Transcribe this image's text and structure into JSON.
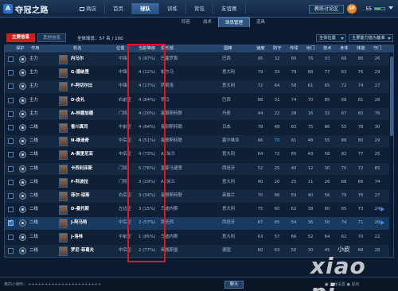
{
  "app": {
    "title": "夺冠之路",
    "logo_mark": "A"
  },
  "nav": [
    "商店",
    "首页",
    "球队",
    "训练",
    "背包",
    "友谊赛"
  ],
  "nav_active": 2,
  "topbar": {
    "forum": "教练讨论区",
    "sp_label": "SP",
    "sp_value": "55",
    "sp_fraction": 0.6
  },
  "subtabs": [
    "阵容",
    "战术",
    "球员管理",
    "道具"
  ],
  "subtab_active": 2,
  "filters": {
    "primary_tab": "主要信息",
    "secondary_tab": "其他信息",
    "count_text": "全体球员：57 名 / 100",
    "position_dropdown": "全体位置",
    "ability_dropdown": "主要能力值为基准"
  },
  "table": {
    "headers": [
      "保护",
      "作用",
      "姓名",
      "位置",
      "当前等级",
      "俱乐部",
      "国籍",
      "速度",
      "防守",
      "传球",
      "射门",
      "技术",
      "身体",
      "体能",
      "守门"
    ],
    "rows": [
      {
        "role": "主力",
        "name": "内马尔",
        "pos": "中锋",
        "starts": "5 (87%)",
        "club": "巴塞罗那",
        "nation": "巴西",
        "stats": [
          "95",
          "32",
          "80",
          "76",
          "93",
          "69",
          "86",
          "26"
        ],
        "hi": [
          4
        ]
      },
      {
        "role": "主力",
        "name": "G-德纳里",
        "pos": "中锋",
        "starts": "4 (12%)",
        "club": "帕尔马",
        "nation": "意大利",
        "stats": [
          "79",
          "33",
          "79",
          "68",
          "77",
          "63",
          "76",
          "29"
        ],
        "hi": []
      },
      {
        "role": "主力",
        "name": "F-阿切尔比",
        "pos": "中锋",
        "starts": "4 (17%)",
        "club": "萨索洛",
        "nation": "意大利",
        "stats": [
          "72",
          "64",
          "58",
          "61",
          "65",
          "72",
          "74",
          "27"
        ],
        "hi": []
      },
      {
        "role": "主力",
        "name": "D-皮礼",
        "pos": "右前卫",
        "starts": "4 (84%)",
        "club": "罗马",
        "nation": "巴西",
        "stats": [
          "88",
          "31",
          "74",
          "70",
          "85",
          "68",
          "81",
          "28"
        ],
        "hi": []
      },
      {
        "role": "主力",
        "name": "A-林德加德",
        "pos": "门将",
        "starts": "4 (20%)",
        "club": "曼联斯特联",
        "nation": "丹麦",
        "stats": [
          "44",
          "22",
          "28",
          "16",
          "32",
          "67",
          "60",
          "76"
        ],
        "hi": []
      },
      {
        "role": "二线",
        "name": "香川真司",
        "pos": "中前卫",
        "starts": "4 (84%)",
        "club": "曼彻斯特联",
        "nation": "日本",
        "stats": [
          "78",
          "48",
          "83",
          "75",
          "86",
          "55",
          "78",
          "30"
        ],
        "hi": []
      },
      {
        "role": "二线",
        "name": "N-维迪奇",
        "pos": "中后卫",
        "starts": "4 (51%)",
        "club": "曼联斯特联",
        "nation": "塞尔维亚",
        "stats": [
          "66",
          "70",
          "61",
          "48",
          "55",
          "88",
          "80",
          "29"
        ],
        "hi": [
          1
        ]
      },
      {
        "role": "二线",
        "name": "A-佩里尼亚",
        "pos": "中后卫",
        "starts": "4 (73%)",
        "club": "AC米兰",
        "nation": "意大利",
        "stats": [
          "64",
          "72",
          "65",
          "43",
          "58",
          "82",
          "77",
          "25"
        ],
        "hi": []
      },
      {
        "role": "二线",
        "name": "卡西利亚斯",
        "pos": "门将",
        "starts": "5 (76%)",
        "club": "皇家马德里",
        "nation": "西班牙",
        "stats": [
          "52",
          "25",
          "40",
          "12",
          "30",
          "70",
          "72",
          "85"
        ],
        "hi": []
      },
      {
        "role": "二线",
        "name": "F-科波拉",
        "pos": "门将",
        "starts": "3 (29%)",
        "club": "AC米兰",
        "nation": "意大利",
        "stats": [
          "40",
          "20",
          "25",
          "11",
          "26",
          "68",
          "66",
          "74"
        ],
        "hi": []
      },
      {
        "role": "二线",
        "name": "菲尔·琼斯",
        "pos": "右后卫",
        "starts": "3 (34%)",
        "club": "曼联斯特联",
        "nation": "英格兰",
        "stats": [
          "70",
          "66",
          "59",
          "40",
          "56",
          "79",
          "76",
          "27"
        ],
        "hi": []
      },
      {
        "role": "二线",
        "name": "D-曼托斯",
        "pos": "左边卫",
        "starts": "3 (15%)",
        "club": "乌迪内斯",
        "nation": "意大利",
        "stats": [
          "75",
          "60",
          "62",
          "38",
          "60",
          "65",
          "73",
          "24"
        ],
        "hi": []
      },
      {
        "role": "二线",
        "name": "J-阿马特",
        "pos": "中后卫",
        "starts": "2 (57%)",
        "club": "斯旺西",
        "nation": "西班牙",
        "stats": [
          "67",
          "65",
          "54",
          "36",
          "50",
          "74",
          "71",
          "26"
        ],
        "hi": []
      },
      {
        "role": "二线",
        "name": "J-洛林",
        "pos": "中前卫",
        "starts": "1 (85%)",
        "club": "乌迪内斯",
        "nation": "意大利",
        "stats": [
          "63",
          "57",
          "66",
          "52",
          "64",
          "62",
          "70",
          "22"
        ],
        "hi": []
      },
      {
        "role": "二线",
        "name": "罗尼·菲葛夫",
        "pos": "中后卫",
        "starts": "2 (77%)",
        "club": "奥格斯堡",
        "nation": "德国",
        "stats": [
          "60",
          "63",
          "50",
          "30",
          "45",
          "71",
          "68",
          "28"
        ],
        "hi": []
      }
    ],
    "selected_row": 12
  },
  "chat": {
    "placeholder": "奥的小喇叭：++++++++++++++++++++++",
    "send": "聊天",
    "links": "● 游戏设置    ● 退出"
  },
  "watermark": {
    "main": "xiao pi",
    "sub": "小皮"
  }
}
